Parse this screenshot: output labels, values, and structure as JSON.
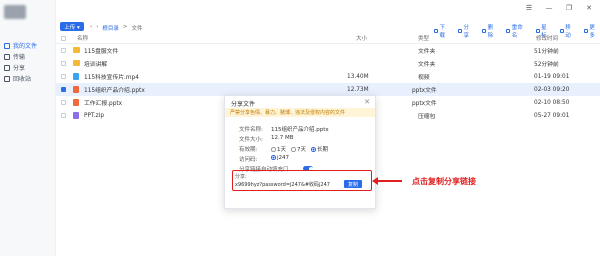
{
  "window": {
    "controls": [
      "☰",
      "—",
      "❐",
      "✕"
    ]
  },
  "sidebar": {
    "items": [
      {
        "label": "我的文件",
        "icon": "folder-icon",
        "active": true
      },
      {
        "label": "传输",
        "icon": "transfer-icon",
        "active": false
      },
      {
        "label": "分享",
        "icon": "share-icon",
        "active": false
      },
      {
        "label": "回收站",
        "icon": "trash-icon",
        "active": false
      }
    ]
  },
  "toolbar": {
    "upload_label": "上传 ▾",
    "breadcrumb": {
      "root": "根目录",
      "sep": ">",
      "current": "文件"
    },
    "actions": [
      {
        "label": "下载",
        "icon": "download-icon"
      },
      {
        "label": "分享",
        "icon": "share-icon"
      },
      {
        "label": "删除",
        "icon": "delete-icon"
      },
      {
        "label": "重命名",
        "icon": "rename-icon"
      },
      {
        "label": "星标",
        "icon": "star-icon"
      },
      {
        "label": "移动",
        "icon": "move-icon"
      },
      {
        "label": "更多",
        "icon": "more-icon"
      }
    ]
  },
  "table": {
    "headers": {
      "name": "名称",
      "size": "大小",
      "type": "类型",
      "modified": "修改时间"
    },
    "rows": [
      {
        "name": "115盘服文件",
        "size": "",
        "type": "文件夹",
        "modified": "51分钟前",
        "icon": "folder-icon",
        "selected": false
      },
      {
        "name": "培训讲解",
        "size": "",
        "type": "文件夹",
        "modified": "52分钟前",
        "icon": "folder-icon",
        "selected": false
      },
      {
        "name": "115科技宣传片.mp4",
        "size": "13.40M",
        "type": "视频",
        "modified": "01-19 09:01",
        "icon": "video-file-icon",
        "selected": false
      },
      {
        "name": "115组织产品介绍.pptx",
        "size": "12.73M",
        "type": "pptx文件",
        "modified": "02-03 09:20",
        "icon": "ppt-file-icon",
        "selected": true
      },
      {
        "name": "工作汇报.pptx",
        "size": "",
        "type": "pptx文件",
        "modified": "02-10 08:50",
        "icon": "ppt-file-icon",
        "selected": false
      },
      {
        "name": "PPT.zip",
        "size": "",
        "type": "压缩包",
        "modified": "05-27 09:01",
        "icon": "zip-file-icon",
        "selected": false
      }
    ]
  },
  "dialog": {
    "title": "分享文件",
    "close": "✕",
    "notice": "严禁分享色情、暴力、赌博、违法及侵权内容的文件",
    "file_name_label": "文件名称:",
    "file_name": "115组织产品介绍.pptx",
    "file_size_label": "文件大小:",
    "file_size": "12.7 MB",
    "validity_label": "有效期:",
    "validity_options": [
      "1天",
      "7天",
      "长期"
    ],
    "code_label": "访问码:",
    "code_value": "j247",
    "auto_fill_label": "分享链接自动填充口",
    "share_label": "分享:",
    "share_link": "x9699hyz?password=j247&#收码j247",
    "copy_label": "复制"
  },
  "annotation": {
    "text": "点击复制分享链接"
  },
  "colors": {
    "accent": "#2b6de8",
    "highlight": "#e02020",
    "selected_row": "#e8f0fe"
  }
}
